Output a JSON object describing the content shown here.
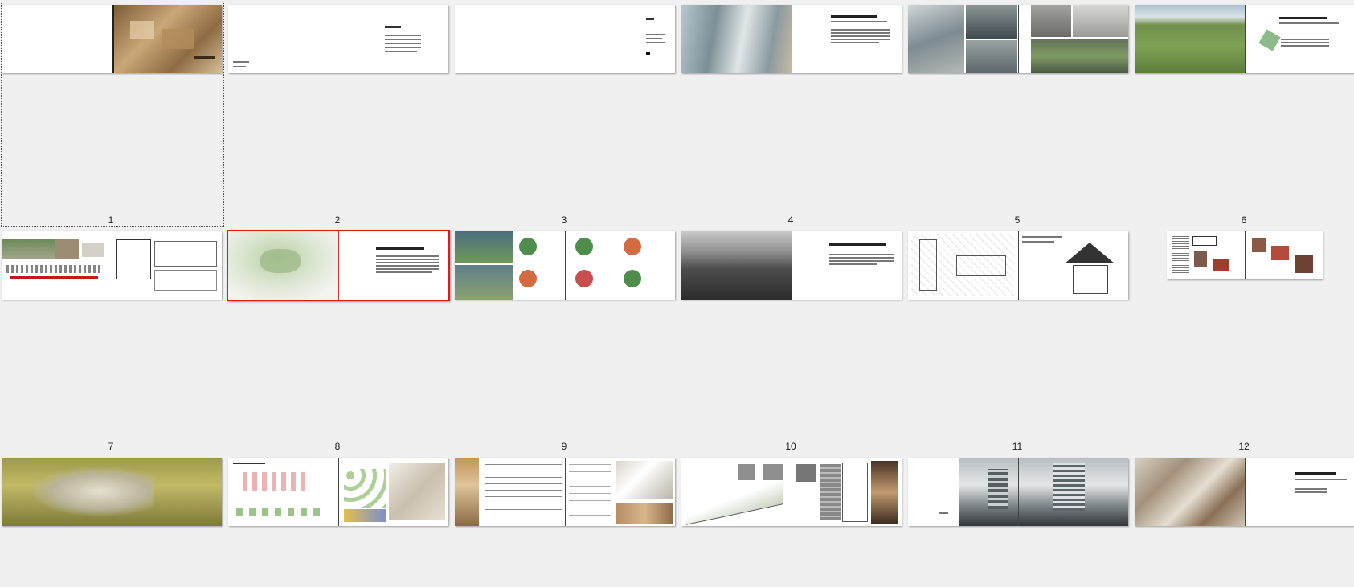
{
  "view": {
    "title": "",
    "zoom": ""
  },
  "rows": [
    {
      "label_row": 1,
      "pages": [
        {
          "number": "1",
          "kind": "cover",
          "selected_outline": true,
          "active": false
        },
        {
          "number": "2",
          "kind": "contents",
          "selected_outline": false,
          "active": false
        },
        {
          "number": "3",
          "kind": "blank-text",
          "selected_outline": false,
          "active": false
        },
        {
          "number": "4",
          "kind": "photo-text",
          "selected_outline": false,
          "active": false
        },
        {
          "number": "5",
          "kind": "photo-grid",
          "selected_outline": false,
          "active": false
        },
        {
          "number": "6",
          "kind": "landscape-text",
          "selected_outline": false,
          "active": false
        }
      ]
    },
    {
      "label_row": 2,
      "pages": [
        {
          "number": "7",
          "kind": "drawings",
          "selected_outline": false,
          "active": false
        },
        {
          "number": "8",
          "kind": "plan-text",
          "selected_outline": false,
          "active": true
        },
        {
          "number": "9",
          "kind": "diagrams",
          "selected_outline": false,
          "active": false
        },
        {
          "number": "10",
          "kind": "landscape-bw",
          "selected_outline": false,
          "active": false
        },
        {
          "number": "11",
          "kind": "sketch-detail",
          "selected_outline": false,
          "active": false
        },
        {
          "number": "12",
          "kind": "small-collage",
          "selected_outline": false,
          "active": false
        }
      ]
    },
    {
      "label_row": 3,
      "pages": [
        {
          "number": "",
          "kind": "city-aerial",
          "selected_outline": false,
          "active": false
        },
        {
          "number": "",
          "kind": "concept-diagrams",
          "selected_outline": false,
          "active": false
        },
        {
          "number": "",
          "kind": "matrix-models",
          "selected_outline": false,
          "active": false
        },
        {
          "number": "",
          "kind": "section-tower",
          "selected_outline": false,
          "active": false
        },
        {
          "number": "",
          "kind": "render-tower",
          "selected_outline": false,
          "active": false
        },
        {
          "number": "",
          "kind": "model-text",
          "selected_outline": false,
          "active": false
        }
      ]
    }
  ],
  "colors": {
    "background": "#f0f0f0",
    "active_border": "#e0191b",
    "outline": "#555555"
  }
}
